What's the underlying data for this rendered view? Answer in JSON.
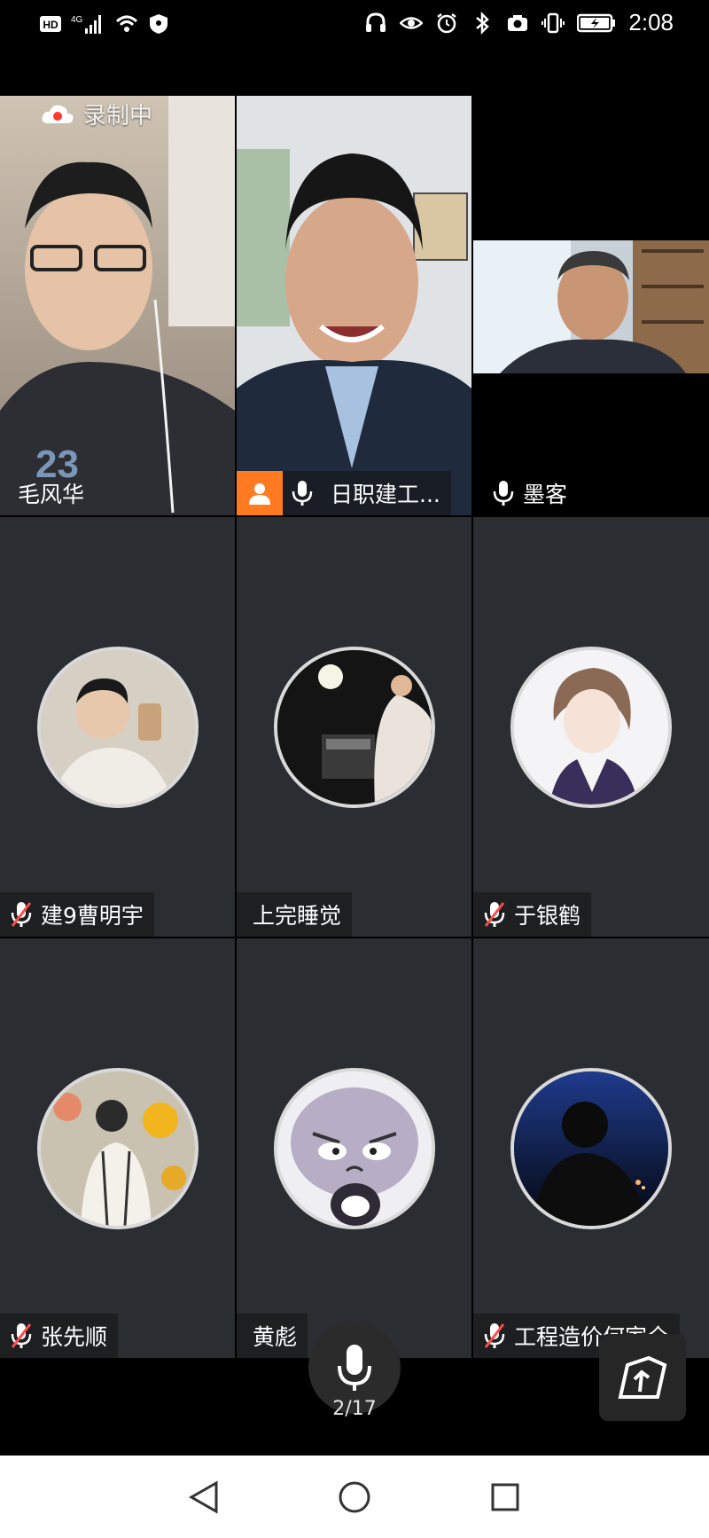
{
  "status_bar": {
    "time": "2:08",
    "left_icons": [
      "hd-icon",
      "4g-signal-icon",
      "signal-bars-icon",
      "wifi-icon",
      "vpn-shield-icon"
    ],
    "right_icons": [
      "headphones-icon",
      "eye-icon",
      "alarm-icon",
      "bluetooth-icon",
      "camera-icon",
      "vibrate-icon",
      "battery-charging-icon"
    ]
  },
  "meeting": {
    "recording_label": "录制中",
    "participants": [
      {
        "name": "毛风华",
        "mic": "none",
        "type": "video",
        "host": false,
        "active": false
      },
      {
        "name": "日职建工...",
        "mic": "on",
        "type": "video",
        "host": true,
        "active": true
      },
      {
        "name": "墨客",
        "mic": "on",
        "type": "video",
        "host": false,
        "active": false
      },
      {
        "name": "建9曹明宇",
        "mic": "muted",
        "type": "avatar",
        "host": false,
        "active": false
      },
      {
        "name": "上完睡觉",
        "mic": "none",
        "type": "avatar",
        "host": false,
        "active": false
      },
      {
        "name": "于银鹤",
        "mic": "muted",
        "type": "avatar",
        "host": false,
        "active": false
      },
      {
        "name": "张先顺",
        "mic": "muted",
        "type": "avatar",
        "host": false,
        "active": false
      },
      {
        "name": "黄彪",
        "mic": "none",
        "type": "avatar",
        "host": false,
        "active": false
      },
      {
        "name": "工程造价何家全",
        "mic": "muted",
        "type": "avatar",
        "host": false,
        "active": false
      }
    ],
    "page_indicator": "2/17"
  },
  "colors": {
    "tile_bg": "#2a2d31",
    "host_badge": "#ff7a21",
    "active_border": "#2fb36b",
    "muted_red": "#ff4a4a"
  },
  "nav": {
    "buttons": [
      "back-icon",
      "home-icon",
      "recents-icon"
    ]
  }
}
